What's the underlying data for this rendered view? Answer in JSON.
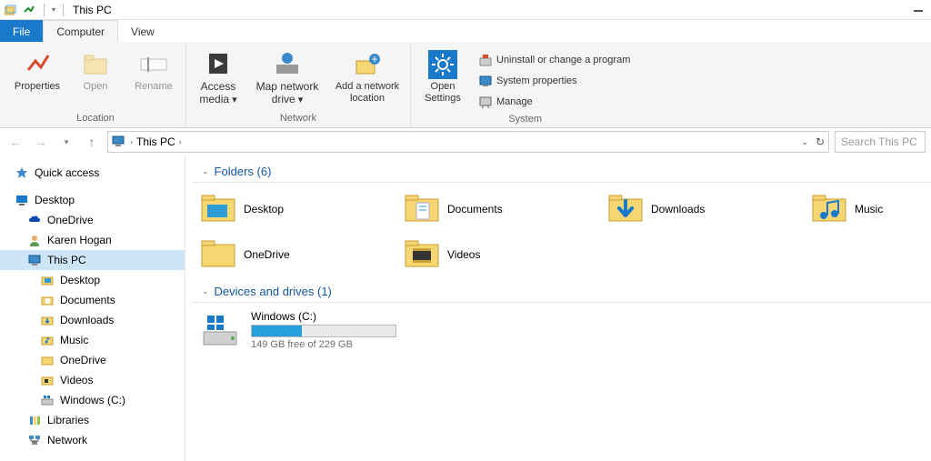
{
  "title": "This PC",
  "tabs": {
    "file": "File",
    "computer": "Computer",
    "view": "View"
  },
  "ribbon": {
    "location": {
      "label": "Location",
      "properties": "Properties",
      "open": "Open",
      "rename": "Rename"
    },
    "network": {
      "label": "Network",
      "access_media": "Access media",
      "map_drive": "Map network drive",
      "add_location": "Add a network location"
    },
    "system": {
      "label": "System",
      "open_settings": "Open Settings",
      "uninstall": "Uninstall or change a program",
      "sys_props": "System properties",
      "manage": "Manage"
    }
  },
  "breadcrumb": {
    "root": "This PC"
  },
  "search_placeholder": "Search This PC",
  "nav": {
    "quick_access": "Quick access",
    "desktop": "Desktop",
    "onedrive": "OneDrive",
    "user": "Karen Hogan",
    "this_pc": "This PC",
    "desktop2": "Desktop",
    "documents": "Documents",
    "downloads": "Downloads",
    "music": "Music",
    "onedrive2": "OneDrive",
    "videos": "Videos",
    "windows_c": "Windows (C:)",
    "libraries": "Libraries",
    "network": "Network"
  },
  "sections": {
    "folders": {
      "title": "Folders (6)"
    },
    "drives": {
      "title": "Devices and drives (1)"
    }
  },
  "folders": {
    "desktop": "Desktop",
    "documents": "Documents",
    "downloads": "Downloads",
    "music": "Music",
    "onedrive": "OneDrive",
    "videos": "Videos"
  },
  "drive": {
    "name": "Windows (C:)",
    "free_text": "149 GB free of 229 GB",
    "used_percent": 35
  }
}
